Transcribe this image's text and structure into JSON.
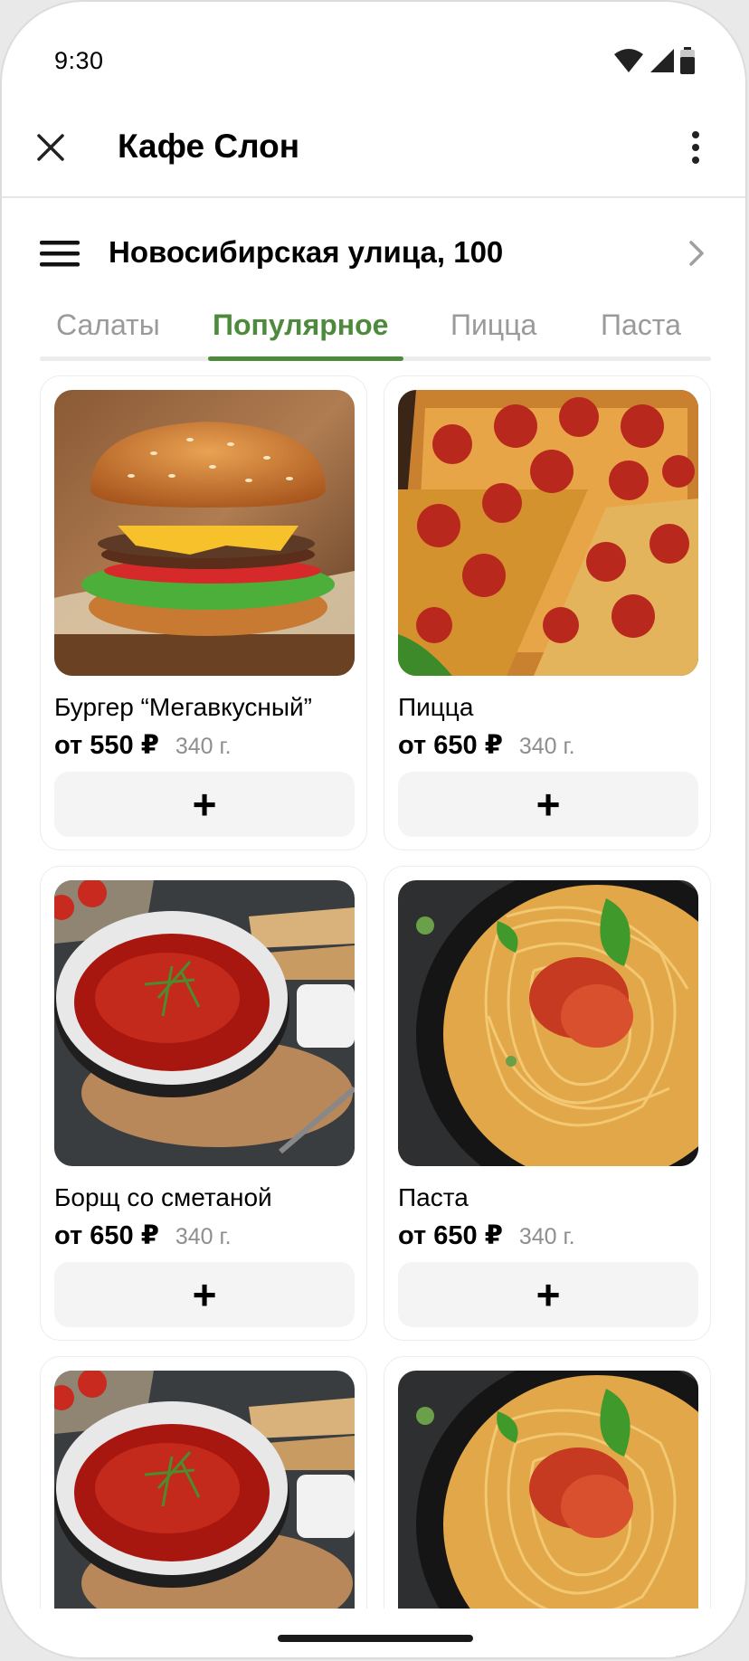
{
  "status_bar": {
    "time": "9:30"
  },
  "app_bar": {
    "title": "Кафе Слон"
  },
  "address": {
    "text": "Новосибирская улица, 100"
  },
  "tabs": [
    {
      "label": "Салаты",
      "active": false
    },
    {
      "label": "Популярное",
      "active": true
    },
    {
      "label": "Пицца",
      "active": false
    },
    {
      "label": "Паста",
      "active": false
    }
  ],
  "products": [
    {
      "name": "Бургер “Мегавкусный”",
      "price": "от 550 ₽",
      "weight": "340 г.",
      "image": "burger-image",
      "add_label": "+"
    },
    {
      "name": "Пицца",
      "price": "от 650 ₽",
      "weight": "340 г.",
      "image": "pizza-image",
      "add_label": "+"
    },
    {
      "name": "Борщ со сметаной",
      "price": "от 650 ₽",
      "weight": "340 г.",
      "image": "borscht-image",
      "add_label": "+"
    },
    {
      "name": "Паста",
      "price": "от 650 ₽",
      "weight": "340 г.",
      "image": "pasta-image",
      "add_label": "+"
    },
    {
      "name": "",
      "price": "",
      "weight": "",
      "image": "borscht-image",
      "add_label": ""
    },
    {
      "name": "",
      "price": "",
      "weight": "",
      "image": "pasta-image",
      "add_label": ""
    }
  ],
  "colors": {
    "accent": "#4d8a3c",
    "inactive_tab": "#9a9a9a",
    "button_bg": "#f4f4f4"
  }
}
